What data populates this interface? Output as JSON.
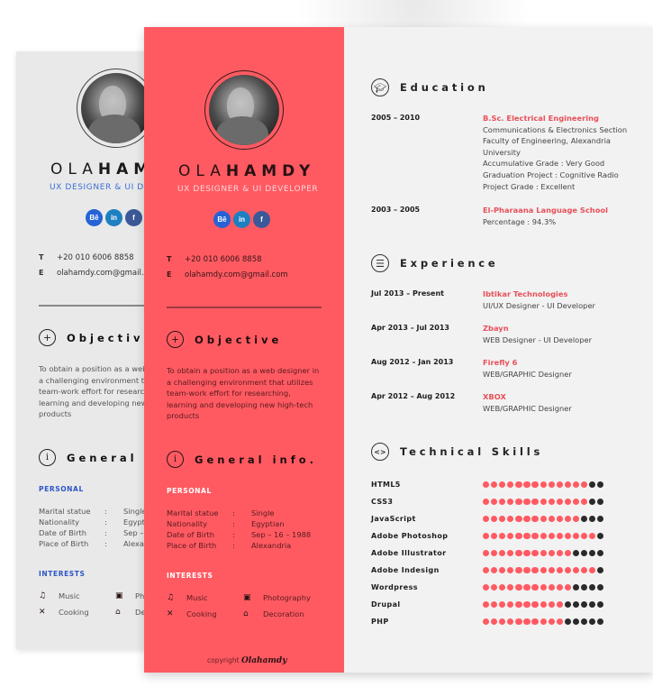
{
  "profile": {
    "first_name": "OLA",
    "last_name": "HAMDY",
    "title": "UX DESIGNER & UI DEVELOPER",
    "socials": [
      {
        "name": "behance-icon",
        "glyph": "Bē"
      },
      {
        "name": "linkedin-icon",
        "glyph": "in"
      },
      {
        "name": "facebook-icon",
        "glyph": "f"
      }
    ],
    "contact": [
      {
        "key": "T",
        "value": "+20 010 6006 8858"
      },
      {
        "key": "E",
        "value": "olahamdy.com@gmail.com"
      }
    ]
  },
  "objective": {
    "heading": "Objective",
    "icon": "plus-icon",
    "text": "To obtain a position as a web designer in a challenging environment that utilizes team-work effort for researching, learning and developing new high-tech products"
  },
  "general": {
    "heading": "General info.",
    "icon": "info-icon",
    "personal_label": "PERSONAL",
    "personal": [
      {
        "key": "Marital statue",
        "sep": ":",
        "value": "Single"
      },
      {
        "key": "Nationality",
        "sep": ":",
        "value": "Egyptian"
      },
      {
        "key": "Date of Birth",
        "sep": ":",
        "value": "Sep – 16 – 1988"
      },
      {
        "key": "Place of Birth",
        "sep": ":",
        "value": "Alexandria"
      }
    ],
    "interests_label": "INTERESTS",
    "interests": [
      {
        "icon": "music-icon",
        "glyph": "♫",
        "label": "Music"
      },
      {
        "icon": "camera-icon",
        "glyph": "▣",
        "label": "Photography"
      },
      {
        "icon": "cooking-icon",
        "glyph": "✕",
        "label": "Cooking"
      },
      {
        "icon": "home-icon",
        "glyph": "⌂",
        "label": "Decoration"
      }
    ]
  },
  "copyright": {
    "prefix": "copyright",
    "signature": "Olahamdy"
  },
  "education": {
    "heading": "Education",
    "icon": "graduation-cap-icon",
    "entries": [
      {
        "date": "2005 – 2010",
        "title": "B.Sc. Electrical Engineering",
        "lines": [
          "Communications & Electronics Section",
          "Faculty of Engineering, Alexandria",
          "University",
          "Accumulative Grade :  Very Good",
          "Graduation Project  : Cognitive Radio",
          "Project Grade          :  Excellent"
        ]
      },
      {
        "date": "2003 – 2005",
        "title": "El-Pharaana Language School",
        "lines": [
          "Percentage   :  94.3%"
        ]
      }
    ]
  },
  "experience": {
    "heading": "Experience",
    "icon": "menu-lines-icon",
    "entries": [
      {
        "date": "Jul 2013 – Present",
        "title": "Ibtikar Technologies",
        "lines": [
          "UI/UX Designer - UI Developer"
        ]
      },
      {
        "date": "Apr 2013 – Jul 2013",
        "title": "Zbayn",
        "lines": [
          "WEB Designer - UI Developer"
        ]
      },
      {
        "date": "Aug 2012 – Jan 2013",
        "title": "Firefly 6",
        "lines": [
          "WEB/GRAPHIC Designer"
        ]
      },
      {
        "date": "Apr 2012 – Aug 2012",
        "title": "XBOX",
        "lines": [
          "WEB/GRAPHIC Designer"
        ]
      }
    ]
  },
  "skills": {
    "heading": "Technical Skills",
    "icon": "code-icon",
    "scale_max": 15,
    "items": [
      {
        "name": "HTML5",
        "level": 13
      },
      {
        "name": "CSS3",
        "level": 13
      },
      {
        "name": "JavaScript",
        "level": 12
      },
      {
        "name": "Adobe Photoshop",
        "level": 14
      },
      {
        "name": "Adobe Illustrator",
        "level": 11
      },
      {
        "name": "Adobe Indesign",
        "level": 14
      },
      {
        "name": "Wordpress",
        "level": 11
      },
      {
        "name": "Drupal",
        "level": 10
      },
      {
        "name": "PHP",
        "level": 10
      }
    ]
  },
  "colors": {
    "accent": "#ff5a62",
    "accent_text": "#e8505a",
    "back_accent": "#2e55c7",
    "panel_bg": "#f2f2f2",
    "dot_off": "#2a2a2a"
  }
}
